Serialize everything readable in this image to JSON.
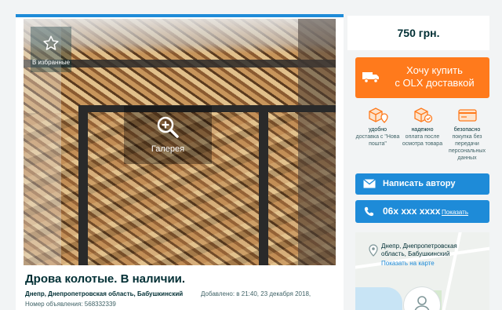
{
  "listing": {
    "favorite_label": "В избранные",
    "gallery_label": "Галерея",
    "title": "Дрова колотые. В наличии.",
    "location": "Днепр, Днепропетровская область, Бабушкинский",
    "added": "Добавлено: в 21:40, 23 декабря 2018,",
    "ad_number": "Номер объявления: 568332339"
  },
  "sidebar": {
    "price": "750 грн.",
    "buy_button": {
      "line1": "Хочу купить",
      "line2": "с OLX доставкой"
    },
    "features": [
      {
        "title": "удобно",
        "desc": "доставка с \"Нова пошта\""
      },
      {
        "title": "надежно",
        "desc": "оплата после осмотра товара"
      },
      {
        "title": "безопасно",
        "desc": "покупка без передачи персональных данных"
      }
    ],
    "message_button": "Написать автору",
    "phone": {
      "number": "06x xxx xxxx",
      "show_label": "Показать"
    },
    "map": {
      "address": "Днепр, Днепропетровская область, Бабушкинский",
      "show_on_map": "Показать на карте"
    }
  },
  "colors": {
    "accent_blue": "#1e8bd8",
    "accent_orange": "#ff7a1c",
    "text_dark": "#002f34"
  }
}
